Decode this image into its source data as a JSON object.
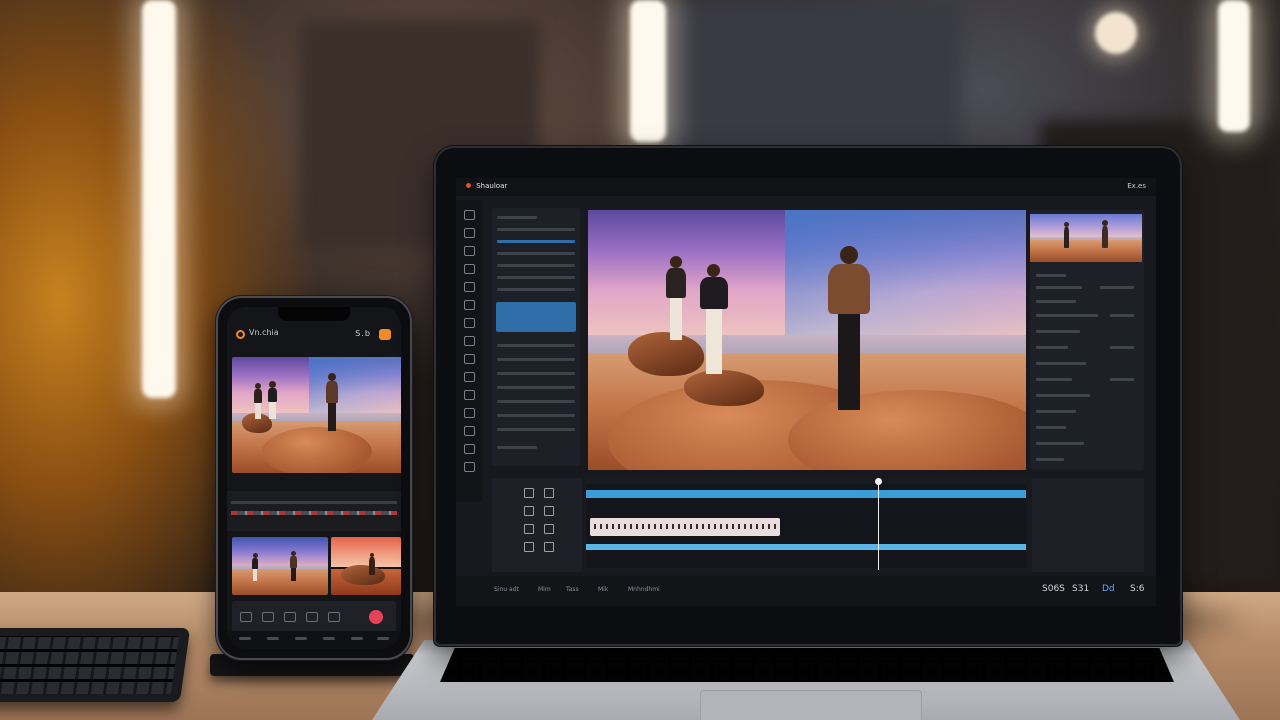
{
  "phone": {
    "app_title": "Vn.chia",
    "menu_label": "S.b"
  },
  "laptop": {
    "app_title": "Shauloar",
    "export_label": "Ex.es",
    "status_items": [
      "Sinu adt",
      "Mim",
      "Tass",
      "Mik",
      "Mnhndhmi"
    ],
    "counters": [
      "S06S",
      "S31",
      "Dd",
      "S:6"
    ]
  },
  "colors": {
    "accent_orange": "#f28a28",
    "timeline_blue": "#3c9ed8",
    "record_pink": "#e6425a"
  }
}
